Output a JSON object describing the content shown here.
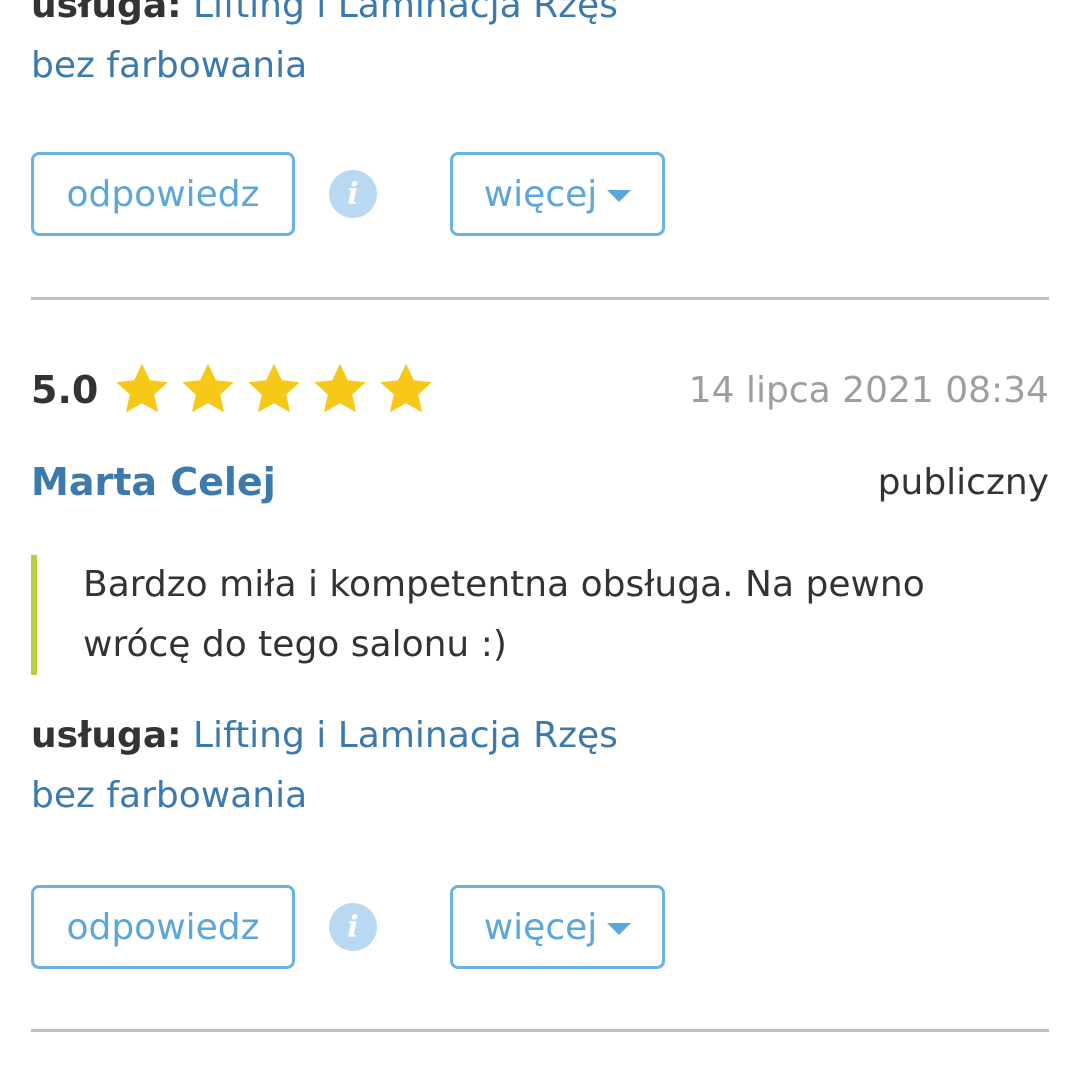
{
  "previous_review": {
    "service_label": "usługa:",
    "service_name_line1": "Lifting i Laminacja Rzęs",
    "service_name_line2": "bez farbowania",
    "reply_label": "odpowiedz",
    "info_icon": "info-icon",
    "more_label": "więcej"
  },
  "review": {
    "rating": "5.0",
    "stars": 5,
    "date": "14 lipca 2021 08:34",
    "author": "Marta Celej",
    "visibility": "publiczny",
    "text_line1": "Bardzo miła i kompetentna obsługa. Na pewno",
    "text_line2": "wrócę do tego salonu :)",
    "service_label": "usługa:",
    "service_name_line1": "Lifting i Laminacja Rzęs",
    "service_name_line2": "bez farbowania",
    "reply_label": "odpowiedz",
    "info_icon": "info-icon",
    "more_label": "więcej"
  },
  "colors": {
    "link": "#3c79ad",
    "button_border": "#6ab3e2",
    "star": "#f6c817",
    "quote_bar": "#b5cf3f",
    "divider": "#bdbdbd"
  }
}
